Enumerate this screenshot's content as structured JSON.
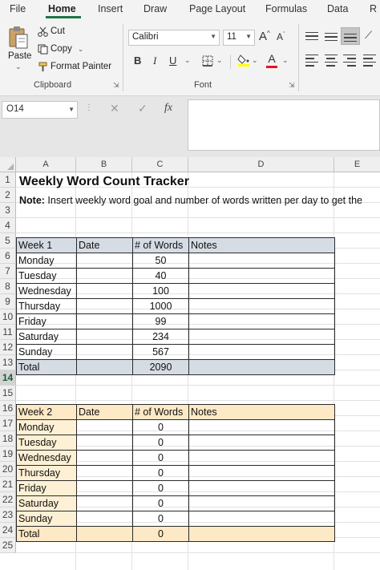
{
  "ribbon": {
    "tabs": [
      "File",
      "Home",
      "Insert",
      "Draw",
      "Page Layout",
      "Formulas",
      "Data",
      "R"
    ],
    "clipboard": {
      "paste_label": "Paste",
      "cut_label": "Cut",
      "copy_label": "Copy",
      "format_painter_label": "Format Painter",
      "group_label": "Clipboard"
    },
    "font": {
      "font_name": "Calibri",
      "font_size": "11",
      "grow_label": "A",
      "shrink_label": "A",
      "bold_label": "B",
      "italic_label": "I",
      "underline_label": "U",
      "fill_label": "",
      "font_color_label": "A",
      "group_label": "Font"
    }
  },
  "formula_bar": {
    "name_box": "O14",
    "cancel_glyph": "✕",
    "enter_glyph": "✓",
    "fx_label": "fx",
    "formula": ""
  },
  "sheet": {
    "columns": [
      "A",
      "B",
      "C",
      "D",
      "E"
    ],
    "row_numbers": [
      "1",
      "2",
      "3",
      "4",
      "5",
      "6",
      "7",
      "8",
      "9",
      "10",
      "11",
      "12",
      "13",
      "14",
      "15",
      "16",
      "17",
      "18",
      "19",
      "20",
      "21",
      "22",
      "23",
      "24",
      "25"
    ],
    "selected_row": "14",
    "title": "Weekly Word Count Tracker",
    "note_label": "Note:",
    "note_text": " Insert weekly word goal and number of words written per day to get the",
    "week1": {
      "headers": [
        "Week 1",
        "Date",
        "# of Words",
        "Notes"
      ],
      "rows": [
        {
          "day": "Monday",
          "words": "50"
        },
        {
          "day": "Tuesday",
          "words": "40"
        },
        {
          "day": "Wednesday",
          "words": "100"
        },
        {
          "day": "Thursday",
          "words": "1000"
        },
        {
          "day": "Friday",
          "words": "99"
        },
        {
          "day": "Saturday",
          "words": "234"
        },
        {
          "day": "Sunday",
          "words": "567"
        }
      ],
      "total_label": "Total",
      "total_value": "2090"
    },
    "week2": {
      "headers": [
        "Week 2",
        "Date",
        "# of Words",
        "Notes"
      ],
      "rows": [
        {
          "day": "Monday",
          "words": "0"
        },
        {
          "day": "Tuesday",
          "words": "0"
        },
        {
          "day": "Wednesday",
          "words": "0"
        },
        {
          "day": "Thursday",
          "words": "0"
        },
        {
          "day": "Friday",
          "words": "0"
        },
        {
          "day": "Saturday",
          "words": "0"
        },
        {
          "day": "Sunday",
          "words": "0"
        }
      ],
      "total_label": "Total",
      "total_value": "0"
    }
  },
  "colors": {
    "excel_green": "#217346",
    "week1_fill": "#d6dce4",
    "week2_fill": "#fde9c5",
    "font_color_red": "#e81123",
    "highlight_yellow": "#ffff00"
  }
}
